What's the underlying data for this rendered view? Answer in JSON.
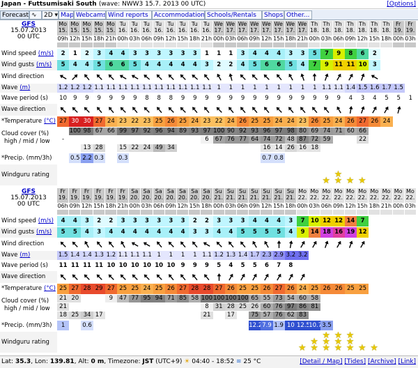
{
  "header": {
    "place": "Japan - Futtsumisaki South",
    "info": "(wave: NWW3 15.7. 2013 00 UTC)",
    "options": "[Options]"
  },
  "tabs": [
    {
      "label": "Forecast",
      "link": false,
      "selected": true
    },
    {
      "label": "∿",
      "link": false,
      "selected": false
    },
    {
      "label": "2D ▾",
      "link": false,
      "selected": false
    },
    {
      "label": "Map",
      "link": true,
      "selected": false
    },
    {
      "label": "Webcams",
      "link": true,
      "selected": false
    },
    {
      "label": "Wind reports",
      "link": true,
      "selected": false
    },
    {
      "label": "Accommodation",
      "link": true,
      "selected": false
    },
    {
      "label": "Schools/Rentals",
      "link": true,
      "selected": false
    },
    {
      "label": "Shops",
      "link": true,
      "selected": false
    },
    {
      "label": "Other...",
      "link": true,
      "selected": false
    }
  ],
  "model": {
    "name": "GFS",
    "date": "15.07.2013",
    "run": "00 UTC"
  },
  "labels": {
    "wind_speed": "Wind speed",
    "wind_gusts": "Wind gusts",
    "unit_ms": "(m/s)",
    "wind_direction": "Wind direction",
    "wave": "Wave",
    "unit_m": "(m)",
    "wave_period": "Wave period (s)",
    "wave_direction": "Wave direction",
    "temperature": "*Temperature",
    "unit_c": "(°C)",
    "cloud1": "Cloud cover (%)",
    "cloud2": "high / mid / low",
    "precip": "*Precip. (mm/3h)",
    "rating": "Windguru rating"
  },
  "sections": [
    {
      "days": [
        "Mo",
        "Mo",
        "Mo",
        "Mo",
        "Mo",
        "Tu",
        "Tu",
        "Tu",
        "Tu",
        "Tu",
        "Tu",
        "Tu",
        "Tu",
        "We",
        "We",
        "We",
        "We",
        "We",
        "We",
        "We",
        "We",
        "Th",
        "Th",
        "Th",
        "Th",
        "Th",
        "Th",
        "Th",
        "Fr",
        "Fr"
      ],
      "dates": [
        "15.",
        "15.",
        "15.",
        "15.",
        "15.",
        "16.",
        "16.",
        "16.",
        "16.",
        "16.",
        "16.",
        "16.",
        "16.",
        "17.",
        "17.",
        "17.",
        "17.",
        "17.",
        "17.",
        "17.",
        "17.",
        "18.",
        "18.",
        "18.",
        "18.",
        "18.",
        "18.",
        "18.",
        "19.",
        "19."
      ],
      "hours": [
        "09h",
        "12h",
        "15h",
        "18h",
        "21h",
        "00h",
        "03h",
        "06h",
        "09h",
        "12h",
        "15h",
        "18h",
        "21h",
        "00h",
        "03h",
        "06h",
        "09h",
        "12h",
        "15h",
        "18h",
        "21h",
        "00h",
        "03h",
        "06h",
        "09h",
        "12h",
        "15h",
        "18h",
        "00h",
        "03h"
      ],
      "weekend": [
        true,
        true,
        true,
        true,
        true,
        false,
        false,
        false,
        false,
        false,
        false,
        false,
        false,
        true,
        true,
        true,
        true,
        true,
        true,
        true,
        true,
        false,
        false,
        false,
        false,
        false,
        false,
        false,
        true,
        true
      ],
      "wind_speed": [
        "2",
        "1",
        "2",
        "3",
        "4",
        "4",
        "3",
        "3",
        "3",
        "3",
        "3",
        "3",
        "1",
        "1",
        "1",
        "3",
        "4",
        "4",
        "4",
        "3",
        "3",
        "5",
        "7",
        "9",
        "8",
        "6",
        "2",
        "",
        "",
        ""
      ],
      "wind_gusts": [
        "5",
        "4",
        "4",
        "5",
        "6",
        "6",
        "5",
        "4",
        "4",
        "4",
        "4",
        "4",
        "3",
        "2",
        "2",
        "4",
        "5",
        "6",
        "6",
        "5",
        "4",
        "7",
        "9",
        "11",
        "11",
        "10",
        "3",
        "",
        "",
        ""
      ],
      "wind_dir": [
        300,
        45,
        320,
        315,
        315,
        300,
        300,
        310,
        315,
        315,
        315,
        310,
        320,
        330,
        345,
        315,
        315,
        315,
        320,
        330,
        340,
        0,
        20,
        30,
        30,
        20,
        300,
        "",
        "",
        ""
      ],
      "wave": [
        "1.2",
        "1.2",
        "1.2",
        "1.1",
        "1.1",
        "1.1",
        "1.1",
        "1.1",
        "1.1",
        "1.1",
        "1.1",
        "1.1",
        "1.1",
        "1",
        "1",
        "1",
        "1",
        "1",
        "1",
        "1",
        "1",
        "1",
        "1.1",
        "1.1",
        "1.4",
        "1.5",
        "1.6",
        "1.7",
        "1.5",
        ""
      ],
      "wave_period": [
        "10",
        "9",
        "9",
        "9",
        "9",
        "9",
        "9",
        "8",
        "8",
        "8",
        "9",
        "9",
        "9",
        "9",
        "9",
        "9",
        "9",
        "9",
        "9",
        "9",
        "9",
        "9",
        "9",
        "9",
        "4",
        "3",
        "4",
        "5",
        "5",
        "1"
      ],
      "wave_dir": [
        315,
        315,
        315,
        320,
        320,
        315,
        320,
        315,
        320,
        315,
        315,
        320,
        320,
        315,
        320,
        320,
        320,
        320,
        315,
        320,
        320,
        320,
        320,
        330,
        10,
        20,
        30,
        30,
        15,
        ""
      ],
      "temperature": [
        "27",
        "30",
        "30",
        "27",
        "24",
        "23",
        "22",
        "23",
        "25",
        "26",
        "25",
        "24",
        "23",
        "22",
        "24",
        "26",
        "25",
        "25",
        "24",
        "24",
        "23",
        "26",
        "25",
        "24",
        "26",
        "27",
        "26",
        "24",
        "",
        ""
      ],
      "cloud_high": [
        "",
        "100",
        "98",
        "67",
        "66",
        "99",
        "97",
        "92",
        "96",
        "94",
        "89",
        "93",
        "97",
        "100",
        "90",
        "92",
        "93",
        "96",
        "97",
        "98",
        "80",
        "69",
        "74",
        "71",
        "60",
        "66",
        "",
        "",
        "",
        ""
      ],
      "cloud_mid": [
        "-",
        "",
        "",
        "",
        "",
        "",
        "",
        "",
        "",
        "",
        "",
        "",
        "6",
        "67",
        "76",
        "77",
        "64",
        "74",
        "72",
        "48",
        "87",
        "72",
        "59",
        "",
        "",
        "22",
        "",
        "",
        "",
        ""
      ],
      "cloud_low": [
        "",
        "",
        "13",
        "28",
        "",
        "15",
        "22",
        "24",
        "49",
        "34",
        "",
        "",
        "",
        "",
        "",
        "",
        "",
        "16",
        "14",
        "26",
        "16",
        "18",
        "",
        "",
        "",
        "",
        "",
        "",
        "",
        ""
      ],
      "precip": [
        "",
        "0.5",
        "2.2",
        "0.3",
        "",
        "0.3",
        "",
        "",
        "",
        "",
        "",
        "",
        "",
        "",
        "",
        "",
        "",
        "0.7",
        "0.8",
        "",
        "",
        "",
        "",
        "",
        "",
        "",
        "",
        "",
        "",
        ""
      ],
      "rating": [
        0,
        0,
        0,
        0,
        0,
        0,
        0,
        0,
        0,
        0,
        0,
        0,
        0,
        0,
        0,
        0,
        0,
        0,
        0,
        0,
        0,
        0,
        1,
        2,
        1,
        1,
        0,
        0,
        0,
        0
      ]
    },
    {
      "days": [
        "Fr",
        "Fr",
        "Fr",
        "Fr",
        "Fr",
        "Fr",
        "Sa",
        "Sa",
        "Sa",
        "Sa",
        "Sa",
        "Sa",
        "Sa",
        "Su",
        "Su",
        "Su",
        "Su",
        "Su",
        "Su",
        "Su",
        "Mo",
        "Mo",
        "Mo",
        "Mo",
        "Mo",
        "Mo",
        "Mo",
        "Mo",
        "Mo",
        "Mo"
      ],
      "dates": [
        "19.",
        "19.",
        "19.",
        "19.",
        "19.",
        "19.",
        "20.",
        "20.",
        "20.",
        "20.",
        "20.",
        "20.",
        "20.",
        "21.",
        "21.",
        "21.",
        "21.",
        "21.",
        "21.",
        "21.",
        "22.",
        "22.",
        "22.",
        "22.",
        "22.",
        "22.",
        "22.",
        "22.",
        "22.",
        "22."
      ],
      "hours": [
        "06h",
        "09h",
        "12h",
        "15h",
        "18h",
        "21h",
        "00h",
        "03h",
        "06h",
        "09h",
        "12h",
        "15h",
        "18h",
        "00h",
        "03h",
        "06h",
        "09h",
        "12h",
        "15h",
        "18h",
        "00h",
        "03h",
        "06h",
        "09h",
        "12h",
        "15h",
        "18h",
        "21h",
        "00h",
        "03h"
      ],
      "weekend": [
        true,
        true,
        true,
        true,
        true,
        true,
        true,
        true,
        true,
        true,
        true,
        true,
        true,
        true,
        true,
        true,
        true,
        true,
        true,
        true,
        false,
        false,
        false,
        false,
        false,
        false,
        false,
        false,
        false,
        false
      ],
      "wind_speed": [
        "4",
        "4",
        "3",
        "2",
        "2",
        "3",
        "3",
        "3",
        "3",
        "3",
        "3",
        "2",
        "2",
        "3",
        "3",
        "3",
        "4",
        "4",
        "4",
        "3",
        "7",
        "10",
        "12",
        "12",
        "14",
        "7",
        "",
        "",
        "",
        ""
      ],
      "wind_gusts": [
        "5",
        "5",
        "4",
        "3",
        "4",
        "4",
        "4",
        "4",
        "4",
        "4",
        "4",
        "3",
        "3",
        "4",
        "4",
        "5",
        "5",
        "5",
        "5",
        "4",
        "9",
        "14",
        "18",
        "16",
        "19",
        "12",
        "",
        "",
        "",
        ""
      ],
      "wind_dir": [
        315,
        315,
        330,
        320,
        320,
        330,
        300,
        300,
        320,
        315,
        320,
        320,
        300,
        315,
        320,
        320,
        330,
        330,
        0,
        10,
        30,
        30,
        20,
        30,
        20,
        30,
        "",
        "",
        "",
        ""
      ],
      "wave": [
        "1.5",
        "1.4",
        "1.4",
        "1.3",
        "1.2",
        "1.1",
        "1.1",
        "1.1",
        "1",
        "1",
        "1",
        "1",
        "1.1",
        "1.2",
        "1.3",
        "1.4",
        "1.7",
        "2.3",
        "2.9",
        "3.2",
        "3.2",
        "",
        "",
        "",
        "",
        "",
        "",
        "",
        "",
        ""
      ],
      "wave_period": [
        "11",
        "11",
        "11",
        "11",
        "10",
        "10",
        "10",
        "10",
        "10",
        "10",
        "9",
        "9",
        "9",
        "5",
        "4",
        "5",
        "5",
        "6",
        "7",
        "8",
        "",
        "",
        "",
        "",
        "",
        "",
        "",
        "",
        "",
        ""
      ],
      "wave_dir": [
        315,
        315,
        315,
        315,
        315,
        315,
        315,
        315,
        315,
        320,
        320,
        320,
        320,
        0,
        30,
        30,
        30,
        30,
        30,
        30,
        30,
        "",
        "",
        "",
        "",
        "",
        "",
        "",
        "",
        ""
      ],
      "temperature": [
        "25",
        "27",
        "28",
        "29",
        "27",
        "25",
        "25",
        "24",
        "25",
        "26",
        "27",
        "28",
        "28",
        "27",
        "26",
        "25",
        "25",
        "26",
        "27",
        "26",
        "24",
        "25",
        "26",
        "26",
        "25",
        "25",
        "",
        "",
        "",
        ""
      ],
      "cloud_high": [
        "21",
        "20",
        "",
        "",
        "9",
        "47",
        "77",
        "95",
        "94",
        "71",
        "85",
        "58",
        "100",
        "100",
        "100",
        "100",
        "65",
        "55",
        "73",
        "54",
        "60",
        "58",
        "",
        "",
        "",
        "",
        "",
        "",
        "",
        ""
      ],
      "cloud_mid": [
        "21",
        "",
        "",
        "",
        "",
        "",
        "",
        "",
        "",
        "",
        "",
        "",
        "8",
        "31",
        "28",
        "25",
        "26",
        "60",
        "76",
        "97",
        "86",
        "81",
        "",
        "",
        "",
        "",
        "",
        "",
        "",
        ""
      ],
      "cloud_low": [
        "18",
        "25",
        "34",
        "17",
        "",
        "",
        "",
        "",
        "",
        "",
        "",
        "",
        "21",
        "",
        "17",
        "",
        "75",
        "57",
        "76",
        "62",
        "83",
        "",
        "",
        "",
        "",
        "",
        "",
        "",
        "",
        ""
      ],
      "precip": [
        "1",
        "",
        "0.6",
        "",
        "",
        "",
        "",
        "",
        "",
        "",
        "",
        "",
        "",
        "",
        "",
        "",
        "12.2",
        "7.9",
        "1.9",
        "10",
        "12.5",
        "10.7",
        "3.5",
        "",
        "",
        "",
        "",
        "",
        "",
        ""
      ],
      "rating": [
        0,
        0,
        0,
        0,
        0,
        0,
        0,
        0,
        0,
        0,
        0,
        0,
        0,
        0,
        0,
        0,
        0,
        0,
        0,
        0,
        1,
        2,
        3,
        3,
        3,
        1,
        1,
        0,
        0,
        0
      ]
    }
  ],
  "footer": {
    "lat_label": "Lat:",
    "lat": "35.3",
    "lon_label": "Lon:",
    "lon": "139.81",
    "alt_label": "Alt:",
    "alt": "0 m",
    "tz_label": "Timezone:",
    "tz": "JST",
    "tz_offset": "(UTC+9)",
    "sun": "04:40 - 18:52",
    "water": "25 °C",
    "links": [
      "[Detail / Map]",
      "[Tides]",
      "[Archive]",
      "[Link]"
    ]
  },
  "colors": {
    "link": "#0000cc",
    "weekend": "#c8c8c8",
    "weekday": "#e2e2e2",
    "temp_hot": "#e03828",
    "temp_warm": "#f07830",
    "wind_low": "#ffffff",
    "wind_mid": "#a0f0ff",
    "wind_high": "#60e060",
    "wind_top": "#f0f000"
  }
}
